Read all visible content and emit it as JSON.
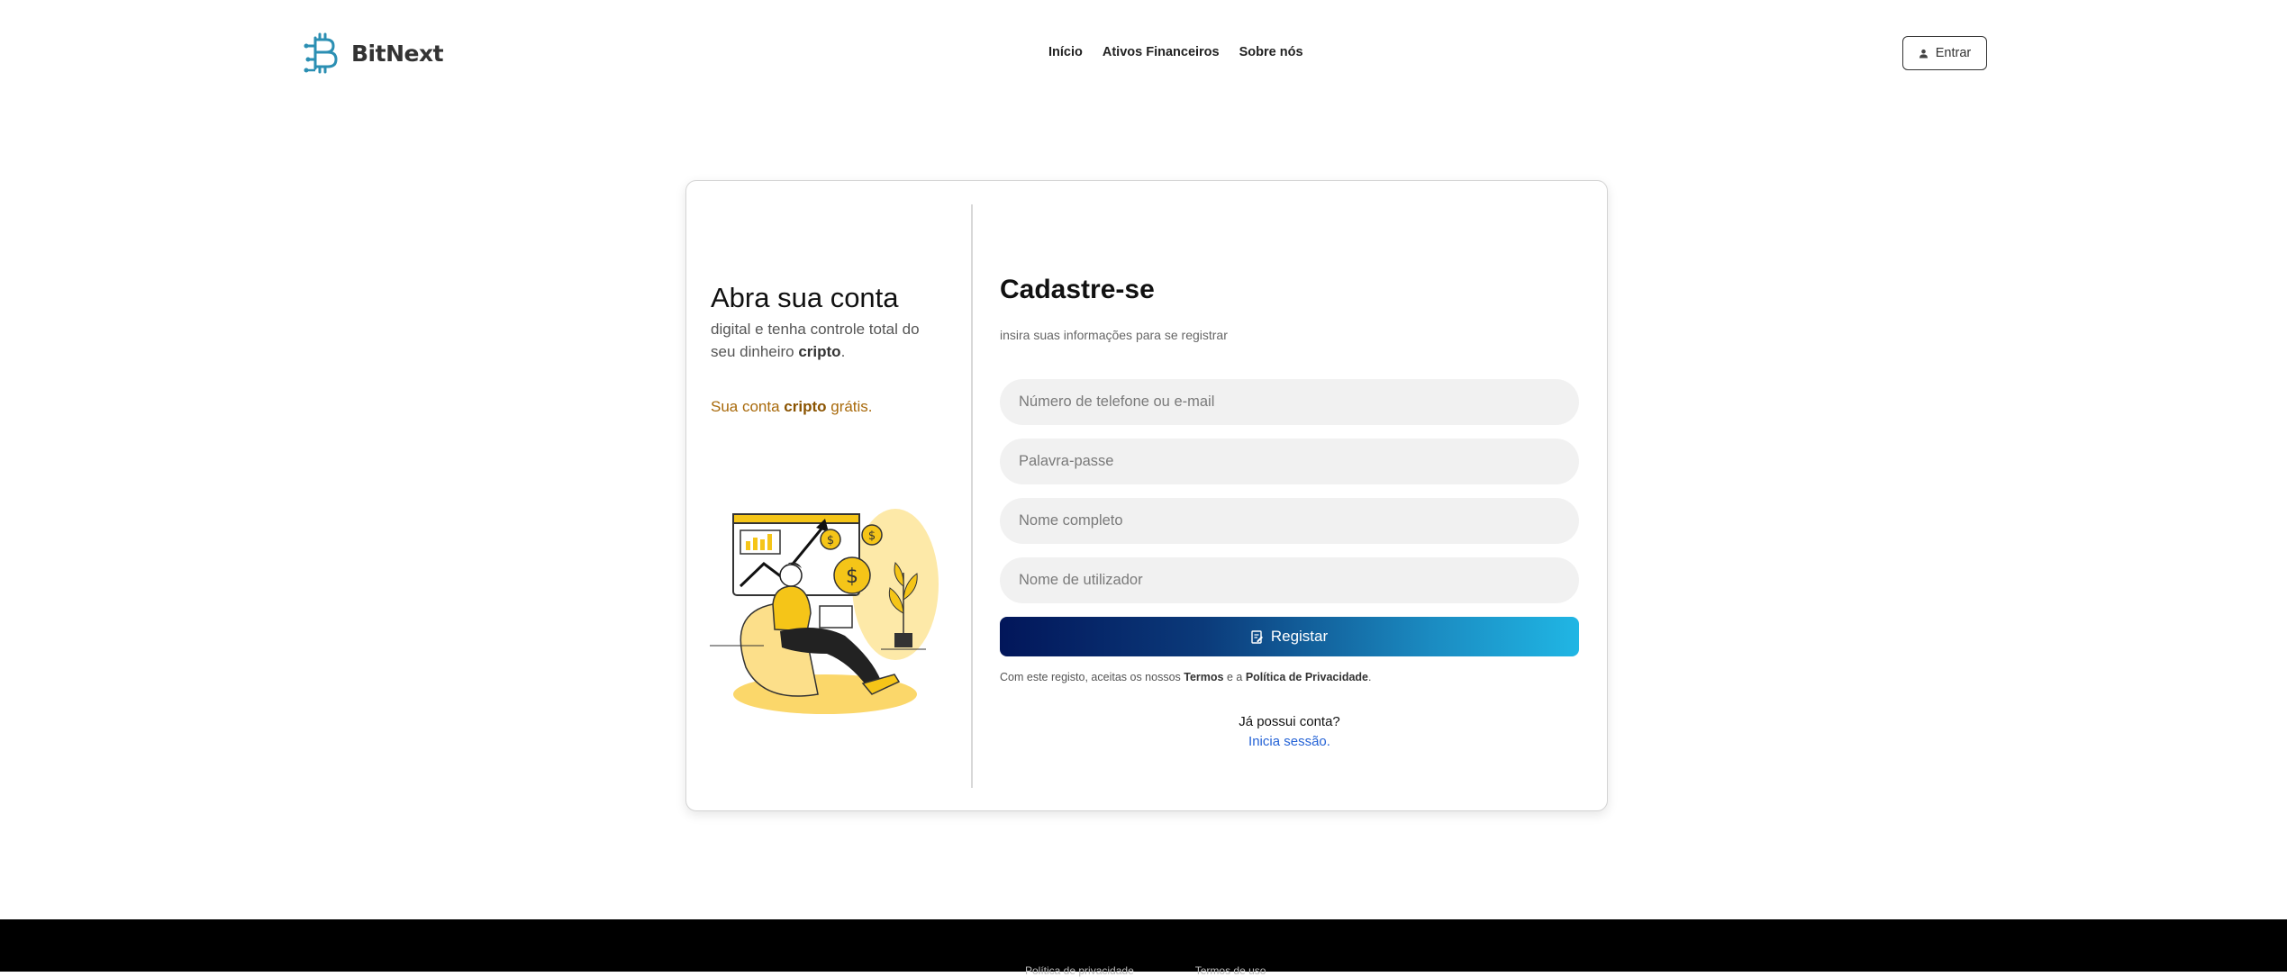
{
  "header": {
    "brand": "BitNext",
    "nav": [
      {
        "label": "Início"
      },
      {
        "label": "Ativos Financeiros"
      },
      {
        "label": "Sobre nós"
      }
    ],
    "login_label": "Entrar"
  },
  "promo": {
    "title": "Abra sua conta",
    "desc_prefix": "digital e tenha controle total do seu dinheiro ",
    "desc_bold": "cripto",
    "desc_suffix": ".",
    "free_prefix": "Sua conta ",
    "free_bold": "cripto",
    "free_suffix": " grátis."
  },
  "form": {
    "title": "Cadastre-se",
    "subtitle": "insira suas informações para se registrar",
    "fields": [
      {
        "placeholder": "Número de telefone ou e-mail",
        "value": ""
      },
      {
        "placeholder": "Palavra-passe",
        "value": ""
      },
      {
        "placeholder": "Nome completo",
        "value": ""
      },
      {
        "placeholder": "Nome de utilizador",
        "value": ""
      }
    ],
    "submit_label": "Registar",
    "terms_prefix": "Com este registo, aceitas os nossos ",
    "terms_link": "Termos",
    "terms_mid": " e a ",
    "privacy_link": "Política de Privacidade",
    "terms_suffix": ".",
    "already_text": "Já possui conta?",
    "signin_link": "Inicia sessão."
  },
  "footer": {
    "links": [
      "Política de privacidade",
      "Termos de uso"
    ]
  },
  "colors": {
    "accent_gold": "#a8690a",
    "link_blue": "#2563d6",
    "button_gradient_start": "#02165a",
    "button_gradient_end": "#20b6e4",
    "logo_teal": "#2b8fb3"
  },
  "icons": {
    "logo": "bitcoin-circuit-logo",
    "login": "user-icon",
    "submit": "register-icon"
  }
}
